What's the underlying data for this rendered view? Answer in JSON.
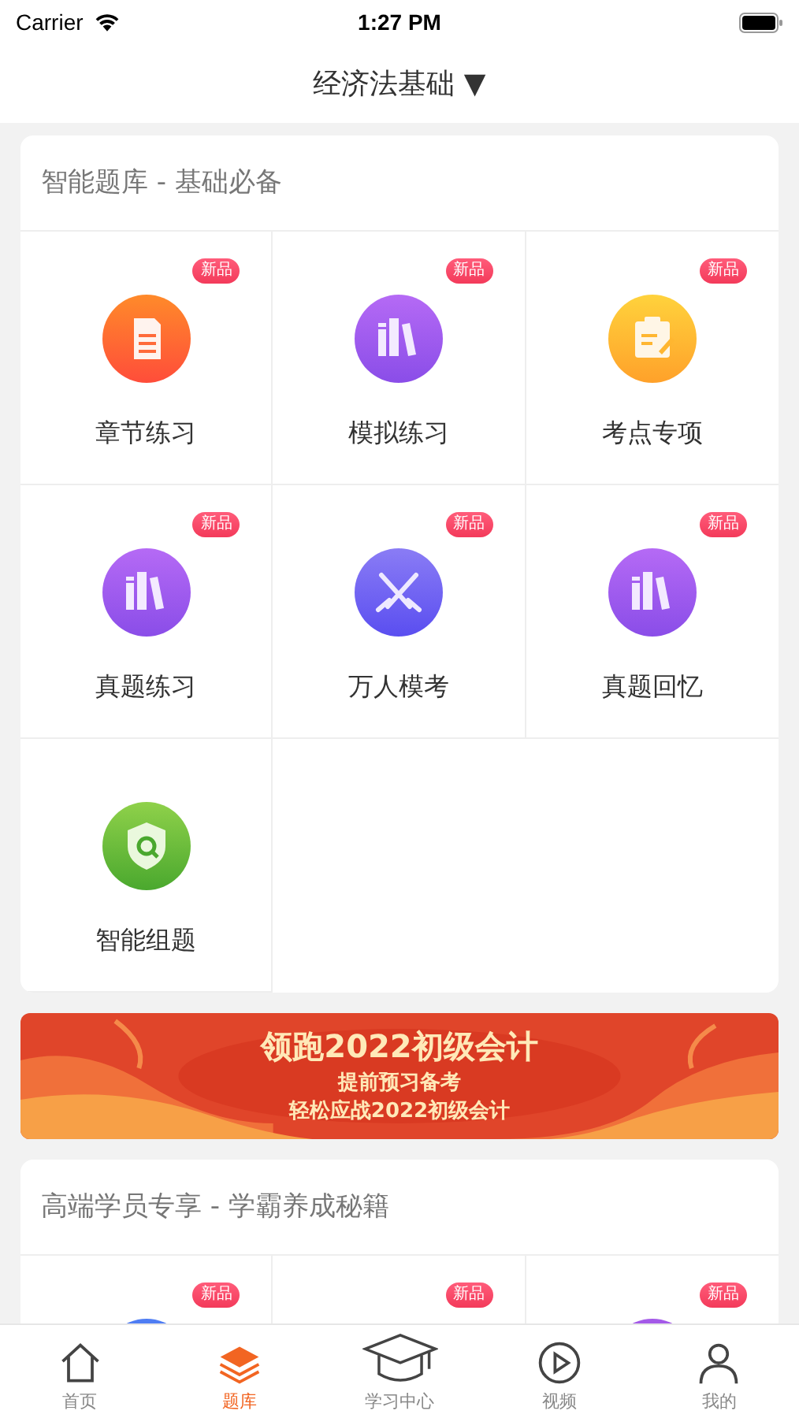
{
  "status_bar": {
    "carrier": "Carrier",
    "time": "1:27 PM"
  },
  "nav": {
    "title": "经济法基础",
    "caret": "▼"
  },
  "sections": [
    {
      "title": "智能题库 - 基础必备",
      "items": [
        {
          "label": "章节练习",
          "badge": "新品",
          "kind": "document"
        },
        {
          "label": "模拟练习",
          "badge": "新品",
          "kind": "books"
        },
        {
          "label": "考点专项",
          "badge": "新品",
          "kind": "clipboard"
        },
        {
          "label": "真题练习",
          "badge": "新品",
          "kind": "books"
        },
        {
          "label": "万人模考",
          "badge": "新品",
          "kind": "swords"
        },
        {
          "label": "真题回忆",
          "badge": "新品",
          "kind": "books"
        },
        {
          "label": "智能组题",
          "kind": "shield"
        }
      ]
    },
    {
      "banner": {
        "headline": "领跑2022初级会计",
        "lines": [
          "提前预习备考",
          "轻松应战2022初级会计"
        ]
      }
    },
    {
      "title": "高端学员专享 - 学霸养成秘籍",
      "items": [
        {
          "badge": "新品",
          "kind": "partial",
          "color": "#4f7df3"
        },
        {
          "badge": "新品",
          "kind": "partial"
        },
        {
          "badge": "新品",
          "kind": "partial",
          "color": "#a45ae8"
        }
      ]
    }
  ],
  "tabs": [
    {
      "label": "首页",
      "selected": false
    },
    {
      "label": "题库",
      "selected": true
    },
    {
      "label": "学习中心",
      "selected": false
    },
    {
      "label": "视频",
      "selected": false
    },
    {
      "label": "我的",
      "selected": false
    }
  ]
}
